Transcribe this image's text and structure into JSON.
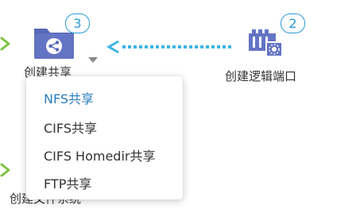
{
  "steps": {
    "share": {
      "label": "创建共享",
      "badge": "3"
    },
    "logical_port": {
      "label": "创建逻辑端口",
      "badge": "2"
    },
    "lower_step": {
      "label": "创建文件系统"
    }
  },
  "menu": {
    "items": [
      {
        "label": "NFS共享",
        "active": true
      },
      {
        "label": "CIFS共享",
        "active": false
      },
      {
        "label": "CIFS Homedir共享",
        "active": false
      },
      {
        "label": "FTP共享",
        "active": false
      }
    ]
  },
  "colors": {
    "accent_blue": "#2a9bd6",
    "folder_blue": "#5667b8",
    "step_green": "#7dc242",
    "arrow_cyan": "#3cb4e6"
  }
}
